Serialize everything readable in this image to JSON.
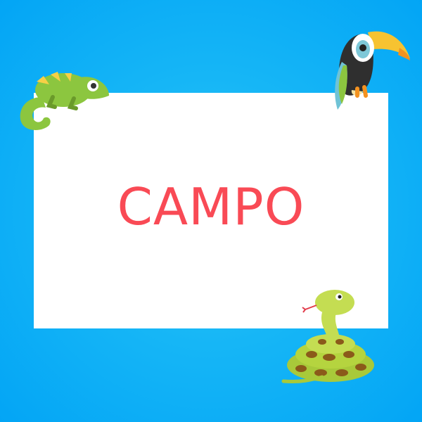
{
  "card": {
    "word": "CAMPO"
  },
  "colors": {
    "word": "#f94a55",
    "background": "#03a5f5",
    "card": "#ffffff"
  },
  "decorations": [
    "chameleon-icon",
    "toucan-icon",
    "snake-icon"
  ]
}
